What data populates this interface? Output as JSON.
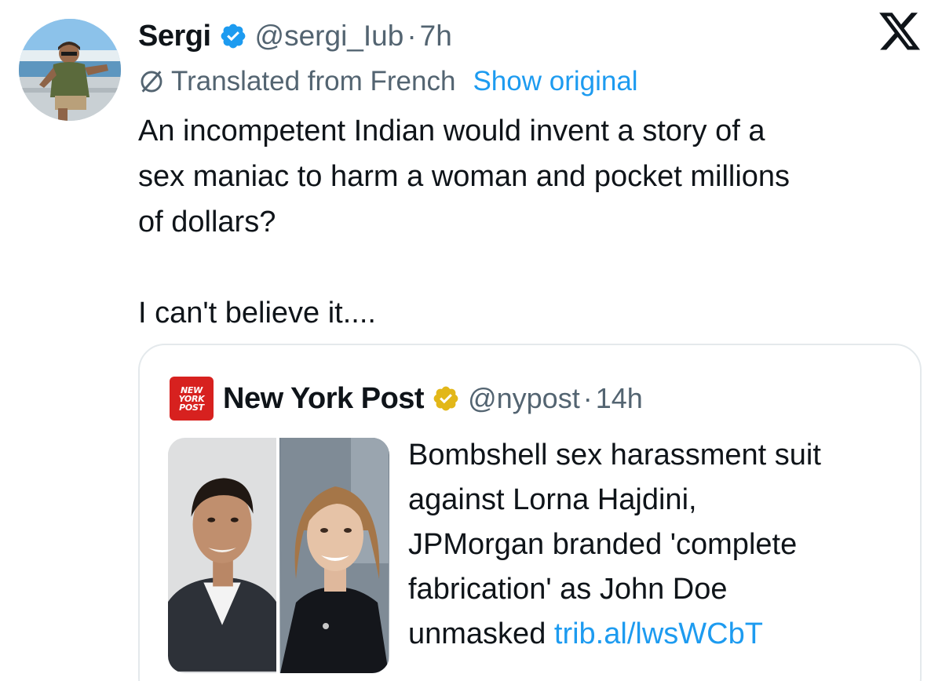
{
  "tweet": {
    "author_name": "Sergi",
    "handle": "@sergi_Iub",
    "separator": "·",
    "time": "7h",
    "avatar_icon": "user-avatar",
    "verified_icon": "verified-badge-icon",
    "verified_color": "#1d9bf0",
    "translated_label": "Translated from French",
    "show_original_label": "Show original",
    "text_lines": [
      "An incompetent Indian would invent a story of a",
      "sex maniac to harm a woman and pocket millions",
      "of dollars?"
    ],
    "text_last": "I can't believe it...."
  },
  "app": {
    "logo_icon": "x-logo-icon"
  },
  "quoted": {
    "logo_lines": [
      "NEW",
      "YORK",
      "POST"
    ],
    "logo_color": "#d7211f",
    "author_name": "New York Post",
    "verified_icon": "gold-verified-badge-icon",
    "verified_color": "#e2b719",
    "handle": "@nypost",
    "separator": "·",
    "time": "14h",
    "text_lines": [
      "Bombshell sex harassment suit",
      "against Lorna Hajdini,",
      "JPMorgan branded 'complete",
      "fabrication' as John Doe"
    ],
    "text_last_prefix": "unmasked ",
    "link": "trib.al/lwsWCbT",
    "link_color": "#1d9bf0"
  }
}
